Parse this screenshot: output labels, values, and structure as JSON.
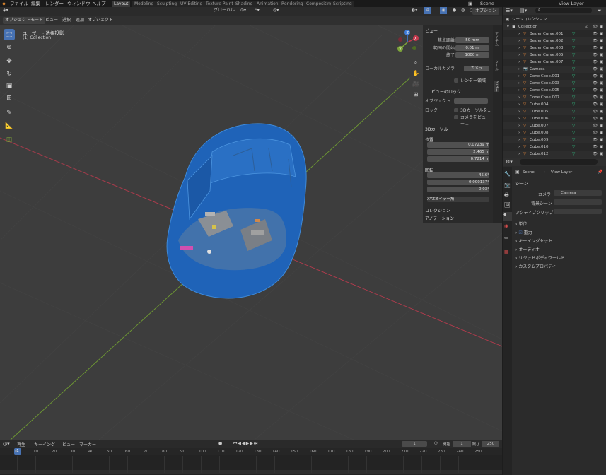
{
  "menubar": {
    "items": [
      "ファイル",
      "編集",
      "レンダー",
      "ウィンドウ",
      "ヘルプ"
    ],
    "workspaces": [
      "Layout",
      "Modeling",
      "Sculpting",
      "UV Editing",
      "Texture Paint",
      "Shading",
      "Animation",
      "Rendering",
      "Compositing",
      "Scripting"
    ],
    "scene": "Scene",
    "view_layer": "View Layer"
  },
  "viewport": {
    "mode": "オブジェクトモード",
    "menus": [
      "ビュー",
      "選択",
      "追加",
      "オブジェクト"
    ],
    "orientation": "グローバル",
    "options": "オプション",
    "overlay_title": "ユーザー・透視投影",
    "overlay_sub": "(1) Collection",
    "gizmo": {
      "x": "X",
      "y": "Y",
      "z": "Z"
    }
  },
  "npanel": {
    "view_header": "ビュー",
    "focal_label": "焦点距離",
    "focal_value": "50 mm",
    "clip_start_label": "範囲の開始",
    "clip_start_value": "0.01 m",
    "clip_end_label": "終了",
    "clip_end_value": "1000 m",
    "local_camera_label": "ローカルカメラ",
    "local_camera_value": "カメラ",
    "render_region": "レンダー領域",
    "view_lock_header": "ビューのロック",
    "lock_object_label": "オブジェクト",
    "lock_label": "ロック",
    "lock_cursor": "3Dカーソルを...",
    "lock_camera": "カメラをビュー...",
    "cursor_header": "3Dカーソル",
    "location_label": "位置",
    "loc_x": "0.07239 m",
    "loc_y": "2.465 m",
    "loc_z": "0.7214 m",
    "rotation_label": "回転",
    "rot_x": "45.6°",
    "rot_y": "0.000137°",
    "rot_z": "-0.03°",
    "rot_mode": "XYZオイラー角",
    "collection_header": "コレクション",
    "annotation_header": "アノテーション",
    "tabs": [
      "アイテム",
      "ツール",
      "ビュー"
    ]
  },
  "outliner": {
    "root": "シーンコレクション",
    "collection": "Collection",
    "items": [
      "Bezier Curve.001",
      "Bezier Curve.002",
      "Bezier Curve.003",
      "Bezier Curve.005",
      "Bezier Curve.007",
      "Camera",
      "Cone Cone.001",
      "Cone Cone.003",
      "Cone Cone.005",
      "Cone Cone.007",
      "Cube.004",
      "Cube.005",
      "Cube.006",
      "Cube.007",
      "Cube.008",
      "Cube.009",
      "Cube.010",
      "Cube.012"
    ]
  },
  "properties": {
    "scene_path_1": "Scene",
    "scene_path_2": "View Layer",
    "scene_header": "シーン",
    "camera_label": "カメラ",
    "camera_value": "Camera",
    "bg_scene_label": "背景シーン",
    "active_clip_label": "アクティブクリップ",
    "sections": [
      "単位",
      "重力",
      "キーイングセット",
      "オーディオ",
      "リジッドボディワールド",
      "カスタムプロパティ"
    ]
  },
  "timeline": {
    "menus": [
      "再生",
      "キーイング",
      "ビュー",
      "マーカー"
    ],
    "current_frame": "1",
    "start_label": "開始",
    "start_value": "1",
    "end_label": "終了",
    "end_value": "250",
    "ticks": [
      "0",
      "10",
      "20",
      "30",
      "40",
      "50",
      "60",
      "70",
      "80",
      "90",
      "100",
      "110",
      "120",
      "130",
      "140",
      "150",
      "160",
      "170",
      "180",
      "190",
      "200",
      "210",
      "220",
      "230",
      "240",
      "250"
    ]
  },
  "colors": {
    "accent": "#4772b3",
    "mesh_blue": "#1f63b8",
    "x_axis": "#c4394d",
    "y_axis": "#7da43a"
  }
}
